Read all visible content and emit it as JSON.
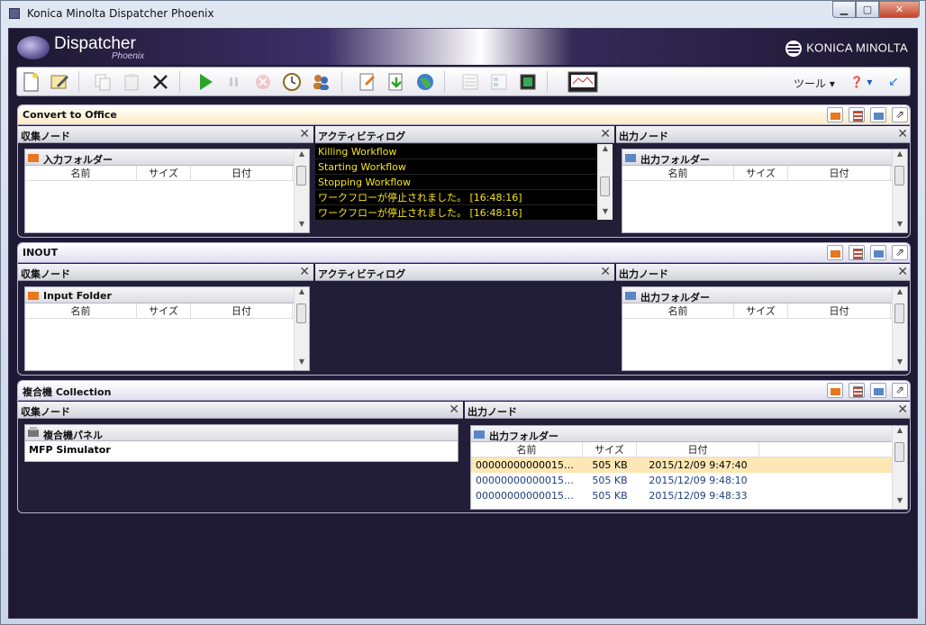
{
  "window": {
    "title": "Konica Minolta Dispatcher Phoenix",
    "min": "▁",
    "max": "▢",
    "close": "✕"
  },
  "banner": {
    "product": "Dispatcher",
    "sub": "Phoenix",
    "brand": "KONICA MINOLTA"
  },
  "toolbar": {
    "tools_label": "ツール ▾",
    "help": "❓ ▾"
  },
  "panels": [
    {
      "title": "Convert to Office",
      "collect": {
        "header": "収集ノード",
        "folder": "入力フォルダー",
        "columns": [
          "名前",
          "サイズ",
          "日付"
        ]
      },
      "log": {
        "header": "アクティビティログ",
        "lines": [
          "Killing Workflow",
          "Starting Workflow",
          "Stopping Workflow",
          "ワークフローが停止されました。 [16:48:16]",
          "ワークフローが停止されました。 [16:48:16]"
        ]
      },
      "output": {
        "header": "出力ノード",
        "folder": "出力フォルダー",
        "columns": [
          "名前",
          "サイズ",
          "日付"
        ]
      }
    },
    {
      "title": "INOUT",
      "collect": {
        "header": "収集ノード",
        "folder": "Input Folder",
        "columns": [
          "名前",
          "サイズ",
          "日付"
        ]
      },
      "log": {
        "header": "アクティビティログ",
        "lines": []
      },
      "output": {
        "header": "出力ノード",
        "folder": "出力フォルダー",
        "columns": [
          "名前",
          "サイズ",
          "日付"
        ]
      }
    },
    {
      "title": "複合機 Collection",
      "collect": {
        "header": "収集ノード",
        "folder": "複合機パネル",
        "item": "MFP Simulator"
      },
      "output": {
        "header": "出力ノード",
        "folder": "出力フォルダー",
        "columns": [
          "名前",
          "サイズ",
          "日付"
        ],
        "rows": [
          {
            "name": "00000000000015…",
            "size": "505 KB",
            "date": "2015/12/09 9:47:40"
          },
          {
            "name": "00000000000015…",
            "size": "505 KB",
            "date": "2015/12/09 9:48:10"
          },
          {
            "name": "00000000000015…",
            "size": "505 KB",
            "date": "2015/12/09 9:48:33"
          }
        ]
      }
    }
  ],
  "icons": {
    "new": "new-document-icon",
    "edit": "edit-notepad-icon",
    "copy": "copy-icon",
    "paste": "paste-icon",
    "delete": "delete-x-icon",
    "play": "play-icon",
    "pause": "pause-icon",
    "stop": "stop-icon",
    "schedule": "clock-icon",
    "users": "users-icon"
  },
  "colors": {
    "log_text": "#f7e51c",
    "selected_row": "#fde7b5",
    "panel_bg": "#231e38",
    "header_highlight": "#fdecc4"
  }
}
